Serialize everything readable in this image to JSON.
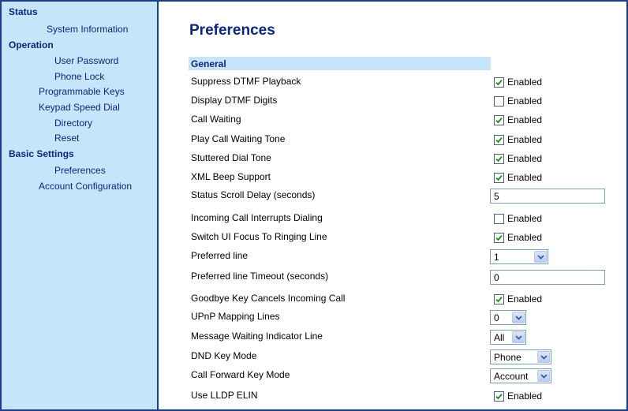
{
  "sidebar": {
    "sections": [
      {
        "title": "Status",
        "items": [
          "System Information"
        ]
      },
      {
        "title": "Operation",
        "items": [
          "User Password",
          "Phone Lock",
          "Programmable Keys",
          "Keypad Speed Dial",
          "Directory",
          "Reset"
        ]
      },
      {
        "title": "Basic Settings",
        "items": [
          "Preferences",
          "Account Configuration"
        ]
      }
    ]
  },
  "page": {
    "title": "Preferences",
    "section": "General"
  },
  "rows": [
    {
      "label": "Suppress DTMF Playback",
      "control": "checkbox",
      "checked": true,
      "text": "Enabled"
    },
    {
      "label": "Display DTMF Digits",
      "control": "checkbox",
      "checked": false,
      "text": "Enabled"
    },
    {
      "label": "Call Waiting",
      "control": "checkbox",
      "checked": true,
      "text": "Enabled"
    },
    {
      "label": "Play Call Waiting Tone",
      "control": "checkbox",
      "checked": true,
      "text": "Enabled"
    },
    {
      "label": "Stuttered Dial Tone",
      "control": "checkbox",
      "checked": true,
      "text": "Enabled"
    },
    {
      "label": "XML Beep Support",
      "control": "checkbox",
      "checked": true,
      "text": "Enabled"
    },
    {
      "label": "Status Scroll Delay (seconds)",
      "control": "text",
      "value": "5"
    },
    {
      "label": "Incoming Call Interrupts Dialing",
      "control": "checkbox",
      "checked": false,
      "text": "Enabled"
    },
    {
      "label": "Switch UI Focus To Ringing Line",
      "control": "checkbox",
      "checked": true,
      "text": "Enabled"
    },
    {
      "label": "Preferred line",
      "control": "select",
      "value": "1"
    },
    {
      "label": "Preferred line Timeout (seconds)",
      "control": "text",
      "value": "0"
    },
    {
      "label": "Goodbye Key Cancels Incoming Call",
      "control": "checkbox",
      "checked": true,
      "text": "Enabled"
    },
    {
      "label": "UPnP Mapping Lines",
      "control": "select",
      "value": "0"
    },
    {
      "label": "Message Waiting Indicator Line",
      "control": "select",
      "value": "All"
    },
    {
      "label": "DND Key Mode",
      "control": "select",
      "value": "Phone"
    },
    {
      "label": "Call Forward Key Mode",
      "control": "select",
      "value": "Account"
    },
    {
      "label": "Use LLDP ELIN",
      "control": "checkbox",
      "checked": true,
      "text": "Enabled"
    }
  ],
  "colors": {
    "frame": "#1a3e8a",
    "sidebar_bg": "#c6e5fb",
    "link": "#0c2680",
    "check": "#1e8a1e"
  },
  "icons": {
    "checkmark": "check-icon",
    "dropdown": "chevron-down-icon"
  }
}
